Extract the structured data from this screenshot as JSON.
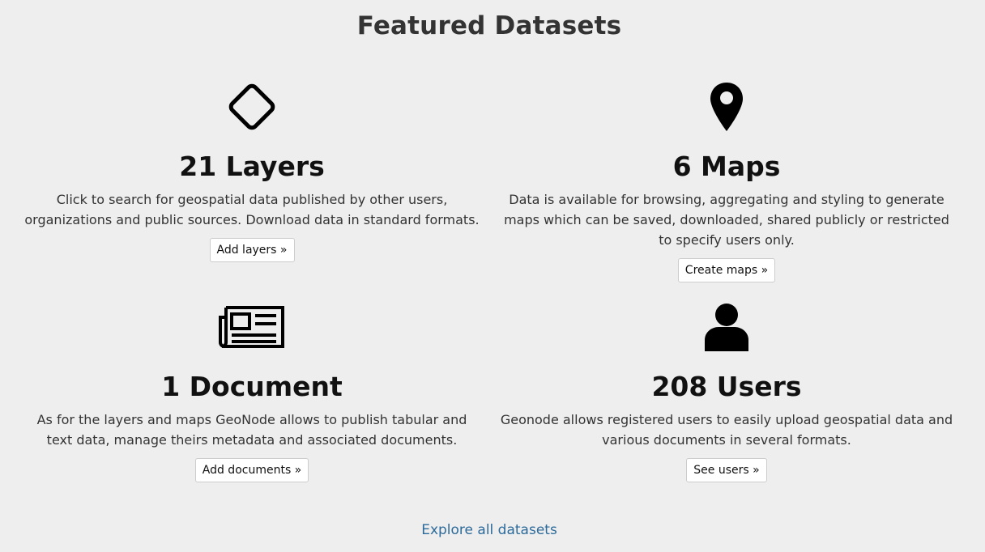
{
  "title": "Featured Datasets",
  "cards": [
    {
      "icon": "diamond-icon",
      "count_label": "21 Layers",
      "description": "Click to search for geospatial data published by other users, organizations and public sources. Download data in standard formats.",
      "button_label": "Add layers »"
    },
    {
      "icon": "map-marker-icon",
      "count_label": "6 Maps",
      "description": "Data is available for browsing, aggregating and styling to generate maps which can be saved, downloaded, shared publicly or restricted to specify users only.",
      "button_label": "Create maps »"
    },
    {
      "icon": "newspaper-icon",
      "count_label": "1 Document",
      "description": "As for the layers and maps GeoNode allows to publish tabular and text data, manage theirs metadata and associated documents.",
      "button_label": "Add documents »"
    },
    {
      "icon": "user-icon",
      "count_label": "208 Users",
      "description": "Geonode allows registered users to easily upload geospatial data and various documents in several formats.",
      "button_label": "See users »"
    }
  ],
  "explore_link": "Explore all datasets",
  "colors": {
    "background": "#eeeeee",
    "link": "#2c6a9a",
    "heading": "#111111"
  }
}
